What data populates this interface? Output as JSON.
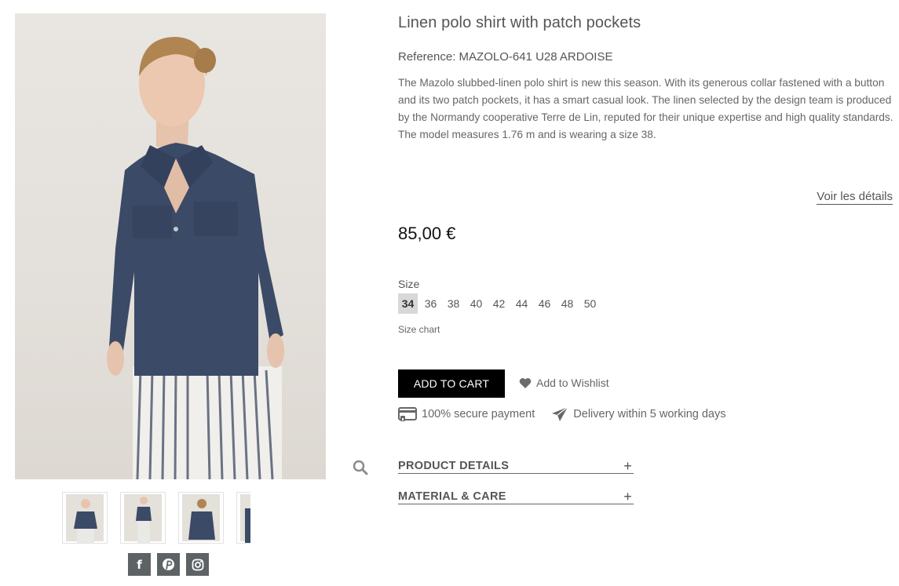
{
  "product": {
    "title": "Linen polo shirt with patch pockets",
    "reference": "Reference: MAZOLO-641 U28 ARDOISE",
    "description": [
      "The Mazolo slubbed-linen polo shirt is new this season. With its generous collar fastened with a button and its two patch pockets, it has a smart casual look. The linen selected by the design team is produced by the Normandy cooperative Terre de Lin, reputed for their unique expertise and high quality standards.",
      "The model measures 1.76 m and is wearing a size 38."
    ],
    "details_link": "Voir les détails",
    "price": "85,00 €"
  },
  "size_selector": {
    "label": "Size",
    "options": [
      "34",
      "36",
      "38",
      "40",
      "42",
      "44",
      "46",
      "48",
      "50"
    ],
    "selected": "34",
    "chart_link": "Size chart"
  },
  "actions": {
    "add_to_cart": "ADD TO CART",
    "wishlist": "Add to Wishlist",
    "wishlist_icon": "heart-icon"
  },
  "reassurance": {
    "payment": "100% secure payment",
    "payment_icon": "credit-card-icon",
    "delivery": "Delivery within 5 working days",
    "delivery_icon": "paper-plane-icon"
  },
  "accordions": {
    "details": "PRODUCT DETAILS",
    "care": "MATERIAL & CARE",
    "toggle_symbol": "+"
  },
  "gallery": {
    "thumbnail_count": 4,
    "zoom_icon": "search-icon"
  },
  "social": {
    "facebook": "f",
    "pinterest": "℗",
    "instagram_icon": "instagram-icon"
  },
  "colors": {
    "shirt": "#3b4a66",
    "trousers_stripe": "#49536a",
    "button_bg": "#000000",
    "social_bg": "#5d6265"
  }
}
